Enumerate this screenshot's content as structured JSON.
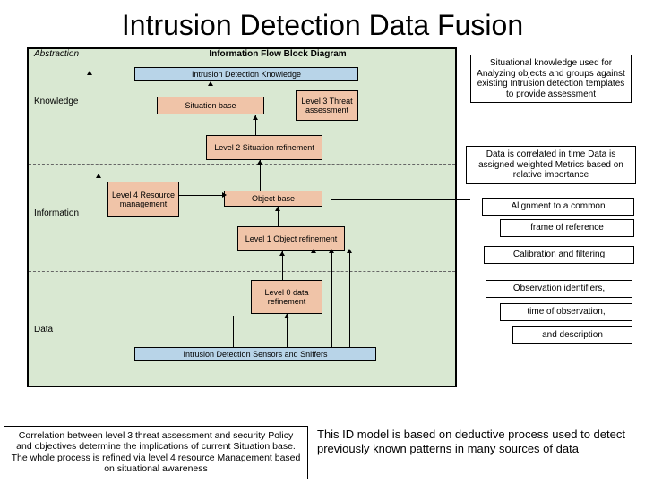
{
  "title": "Intrusion Detection Data Fusion",
  "diagram": {
    "header_left": "Abstraction",
    "header_center": "Information Flow Block Diagram",
    "section_knowledge": "Knowledge",
    "section_information": "Information",
    "section_data": "Data",
    "blocks": {
      "idk": "Intrusion Detection Knowledge",
      "situation_base": "Situation base",
      "l3": "Level 3 Threat assessment",
      "l2": "Level 2 Situation refinement",
      "l4": "Level 4 Resource management",
      "object_base": "Object base",
      "l1": "Level 1 Object refinement",
      "l0": "Level 0 data refinement",
      "sensors": "Intrusion Detection Sensors and Sniffers"
    }
  },
  "annotations": {
    "a1": "Situational knowledge used for Analyzing objects and groups against existing Intrusion detection templates to provide assessment",
    "a2": "Data is correlated in time Data is assigned weighted Metrics based on relative importance",
    "a3a": "Alignment to a common",
    "a3b": "frame of reference",
    "a4": "Calibration and filtering",
    "a5a": "Observation identifiers,",
    "a5b": "time of observation,",
    "a5c": "and description"
  },
  "bottom": {
    "left": "Correlation between level 3 threat assessment and security Policy and objectives determine the implications of current Situation base. The whole process is refined via level 4 resource Management based on situational awareness",
    "right": "This ID model is based on deductive process used to detect previously known patterns in many sources of data"
  }
}
